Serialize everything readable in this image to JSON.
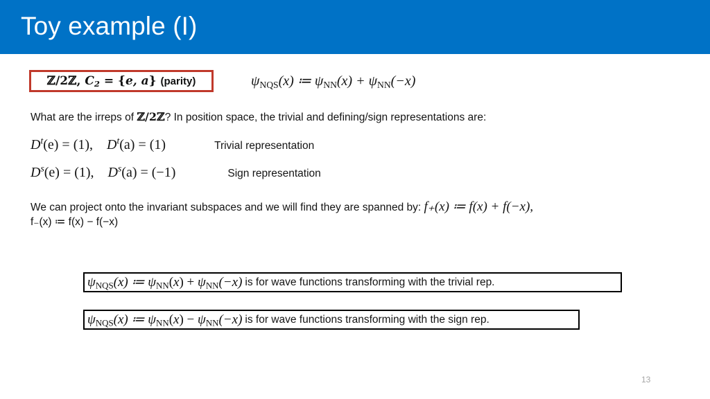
{
  "slide": {
    "title": "Toy example (I)",
    "page_number": "13",
    "banner_color": "#0072c6",
    "highlight_box_color": "#c0392b",
    "box_border_color": "#000000"
  },
  "group_box": {
    "group_symbol": "ℤ/2ℤ",
    "separator": ", ",
    "group_name": "C",
    "group_subscript": "2",
    "equals": " = {",
    "elements": "e, a",
    "close": "} ",
    "parity_label": "(parity)",
    "full_text": "ℤ/2ℤ, C₂ = {e, a} (parity)"
  },
  "top_formula": {
    "lhs": "ψ",
    "lhs_sub": "NQS",
    "lhs_arg": "(x) ≔ ",
    "rhs1": "ψ",
    "rhs1_sub": "NN",
    "rhs1_arg": "(x) + ",
    "rhs2": "ψ",
    "rhs2_sub": "NN",
    "rhs2_arg": "(−x)",
    "full_text": "ψNQS(x) ≔ ψNN(x) + ψNN(−x)"
  },
  "question_line": {
    "part1": "What are the irreps of ",
    "group": "ℤ/2ℤ",
    "part2": "?  In position space, the trivial and defining/sign representations are:"
  },
  "representations": [
    {
      "name": "trivial",
      "symbol": "D",
      "superscript": "t",
      "eq_identity": "(e) = (1),",
      "eq_element": "(a) = (1)",
      "equations": "Dᵗ(e) = (1),    Dᵗ(a) = (1)",
      "label": "Trivial representation"
    },
    {
      "name": "sign",
      "symbol": "D",
      "superscript": "s",
      "eq_identity": "(e) = (1),",
      "eq_element": "(a) = (−1)",
      "equations": "Dˢ(e) = (1),    Dˢ(a) = (−1)",
      "label": "Sign representation"
    }
  ],
  "projection": {
    "line1_text": "We can project onto the invariant subspaces and we will find they are spanned by: ",
    "line1_formula": "f₊(x) ≔ f(x) + f(−x),",
    "line2_formula": "f₋(x) ≔ f(x) − f(−x)"
  },
  "conclusions": [
    {
      "id": "trivial-rep-box",
      "formula": "ψNQS(x) ≔ ψNN(x) + ψNN(−x)",
      "operator": "+",
      "text": "is for wave functions transforming with the trivial rep."
    },
    {
      "id": "sign-rep-box",
      "formula": "ψNQS(x) ≔ ψNN(x) − ψNN(−x)",
      "operator": "−",
      "text": "is for wave functions transforming with the sign rep."
    }
  ]
}
